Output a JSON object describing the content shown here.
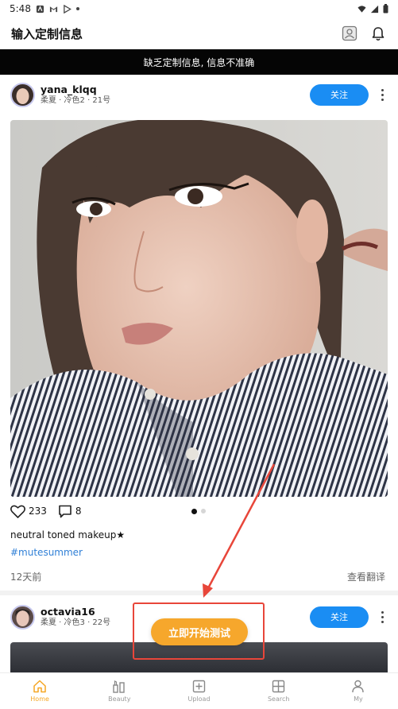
{
  "status_bar": {
    "time": "5:48"
  },
  "topbar": {
    "title": "输入定制信息"
  },
  "banner": {
    "text": "缺乏定制信息, 信息不准确"
  },
  "posts": [
    {
      "username": "yana_klqq",
      "meta": "柔夏 · 冷色2 · 21号",
      "follow_label": "关注",
      "likes": "233",
      "comments": "8",
      "caption": "neutral toned makeup★",
      "hashtag": "#mutesummer",
      "time_ago": "12天前",
      "translate_label": "查看翻译",
      "carousel": {
        "count": 2,
        "active_index": 0
      }
    },
    {
      "username": "octavia16",
      "meta": "柔夏 · 冷色3 · 22号",
      "follow_label": "关注"
    }
  ],
  "cta": {
    "label": "立即开始测试"
  },
  "bottom_nav": {
    "items": [
      {
        "label": "Home",
        "icon": "home-icon",
        "active": true
      },
      {
        "label": "Beauty",
        "icon": "beauty-icon",
        "active": false
      },
      {
        "label": "Upload",
        "icon": "upload-icon",
        "active": false
      },
      {
        "label": "Search",
        "icon": "search-icon",
        "active": false
      },
      {
        "label": "My",
        "icon": "profile-icon",
        "active": false
      }
    ]
  },
  "colors": {
    "accent_blue": "#1a8df3",
    "cta_orange": "#f6a72c",
    "nav_active": "#f5a623",
    "annotation_red": "#e8463a",
    "hashtag_blue": "#2f7fd6"
  }
}
